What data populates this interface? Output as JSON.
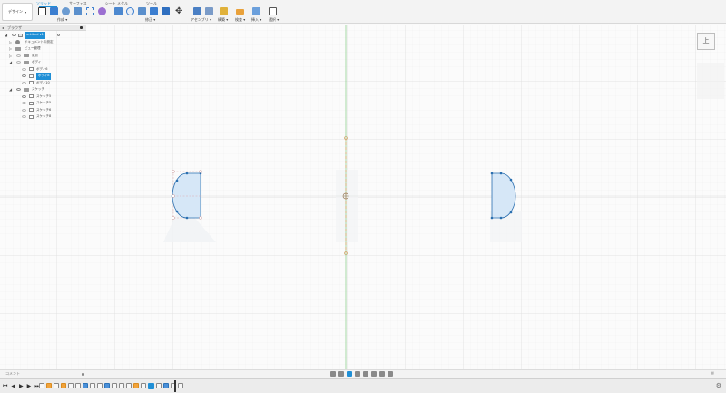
{
  "toolbar": {
    "workspace_label": "デザイン",
    "tabs": [
      {
        "label": "ソリッド",
        "active": true
      },
      {
        "label": "サーフェス",
        "active": false
      },
      {
        "label": "シート メタル",
        "active": false
      },
      {
        "label": "ツール",
        "active": false
      }
    ],
    "groups": [
      "作成",
      "修正",
      "アセンブリ",
      "構築",
      "検査",
      "挿入",
      "選択"
    ]
  },
  "browser": {
    "title": "ブラウザ",
    "items": [
      {
        "label": "untitled v1",
        "level": 0,
        "selected": true
      },
      {
        "label": "ドキュメントの設定",
        "level": 1
      },
      {
        "label": "ビュー管理",
        "level": 1
      },
      {
        "label": "原点",
        "level": 1
      },
      {
        "label": "ボディ",
        "level": 1
      },
      {
        "label": "ボディ6",
        "level": 2
      },
      {
        "label": "ボディ8",
        "level": 2,
        "selected": true
      },
      {
        "label": "ボディ10",
        "level": 2
      },
      {
        "label": "スケッチ",
        "level": 1
      },
      {
        "label": "スケッチ5",
        "level": 2
      },
      {
        "label": "スケッチ5",
        "level": 2
      },
      {
        "label": "スケッチ6",
        "level": 2
      },
      {
        "label": "スケッチ8",
        "level": 2
      }
    ]
  },
  "viewcube": {
    "label": "上"
  },
  "comments": {
    "label": "コメント"
  },
  "playback": [
    "⏮",
    "◀",
    "▶",
    "▶",
    "⏭"
  ],
  "colors": {
    "accent": "#1f8fd6",
    "sketch_line": "#2a6fb0",
    "sketch_fill": "#cfe3f5",
    "axis_green": "#86c98a",
    "axis_orange": "#d7a86b",
    "grid": "#e6e6e6",
    "grid_major": "#d9d9d9"
  }
}
